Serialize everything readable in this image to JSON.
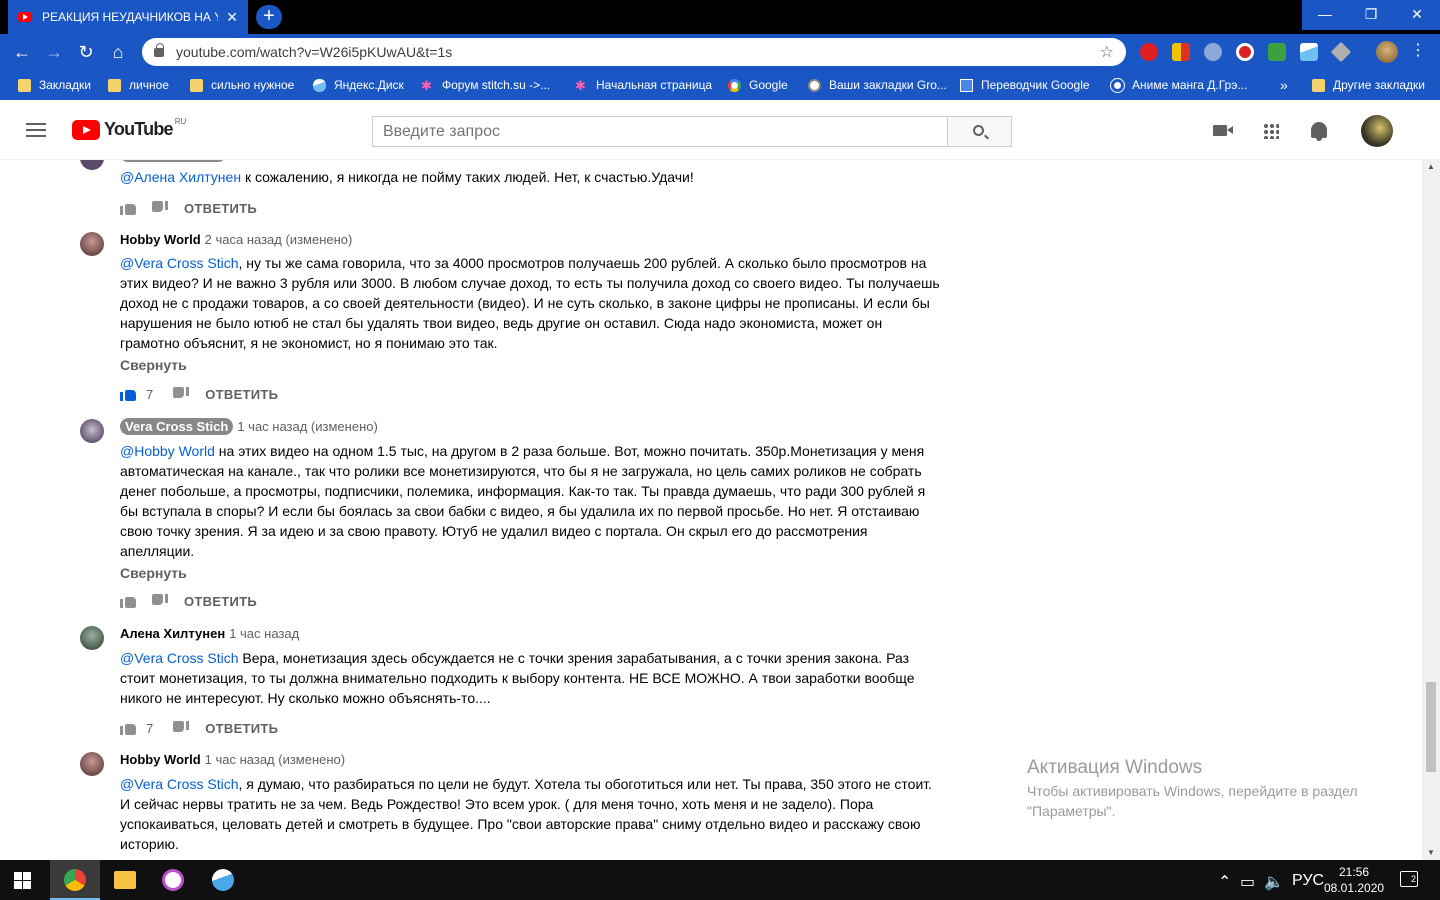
{
  "browser": {
    "tab_title": "РЕАКЦИЯ НЕУДАЧНИКОВ НА YOUTUBE",
    "url": "youtube.com/watch?v=W26i5pKUwAU&t=1s",
    "bookmarks": [
      {
        "label": "Закладки",
        "icon": "folder-icon"
      },
      {
        "label": "личное",
        "icon": "folder-icon"
      },
      {
        "label": "сильно нужное",
        "icon": "folder-icon"
      },
      {
        "label": "Яндекс.Диск",
        "icon": "yandex-disk-icon"
      },
      {
        "label": "Форум stitch.su ->...",
        "icon": "stitch-icon"
      },
      {
        "label": "Начальная страница",
        "icon": "stitch-icon"
      },
      {
        "label": "Google",
        "icon": "google-icon"
      },
      {
        "label": "Ваши закладки Gro...",
        "icon": "grammarly-icon"
      },
      {
        "label": "Переводчик Google",
        "icon": "translate-icon"
      },
      {
        "label": "Аниме манга Д.Грэ...",
        "icon": "anime-icon"
      }
    ],
    "bookmarks_more": "»",
    "other_bookmarks": "Другие закладки"
  },
  "youtube": {
    "logo_text": "YouTube",
    "region": "RU",
    "search_placeholder": "Введите запрос"
  },
  "comments": [
    {
      "author": "",
      "time": "",
      "mention": "@Алена Хилтунен",
      "text": " к сожалению, я никогда не пойму таких людей. Нет, к счастью.Удачи!",
      "likes": "",
      "collapse": ""
    },
    {
      "author": "Hobby World",
      "time": "2 часа назад (изменено)",
      "mention": "@Vera Cross Stich",
      "text": ", ну ты же сама говорила, что за 4000 просмотров получаешь 200 рублей. А сколько было просмотров на этих видео? И не важно 3 рубля или 3000. В любом случае доход, то есть ты получила доход со своего видео. Ты получаешь доход не с продажи товаров, а со своей деятельности (видео).  И не суть сколько, в законе цифры не прописаны. И если бы нарушения не было ютюб не стал бы удалять твои видео, ведь другие он оставил. Сюда надо экономиста, может он грамотно объяснит, я не экономист, но я понимаю это так.",
      "likes": "7",
      "collapse": "Свернуть"
    },
    {
      "author": "Vera Cross Stich",
      "time": "1 час назад (изменено)",
      "mention": "@Hobby World",
      "text": " на этих видео на одном 1.5 тыс, на другом в 2 раза больше. Вот, можно почитать. 350р.Монетизация у меня автоматическая на канале., так что ролики все монетизируются, что бы я не загружала, но цель самих роликов не собрать денег побольше, а просмотры, подписчики, полемика, информация. Как-то так. Ты правда думаешь, что ради 300 рублей я бы вступала в споры? И если бы боялась за свои бабки с видео, я бы удалила их по первой просьбе. Но нет. Я отстаиваю свою точку зрения. Я за идею и за свою правоту. Ютуб не удалил видео с портала. Он скрыл его до рассмотрения апелляции.",
      "likes": "",
      "collapse": "Свернуть"
    },
    {
      "author": "Алена Хилтунен",
      "time": "1 час назад",
      "mention": "@Vera Cross Stich",
      "text": " Вера, монетизация здесь обсуждается не с точки зрения зарабатывания, а с точки зрения закона. Раз стоит монетизация, то ты должна внимательно подходить к выбору контента. НЕ ВСЕ МОЖНО. А твои заработки вообще никого не интересуют. Ну сколько можно объяснять-то....",
      "likes": "7",
      "collapse": ""
    },
    {
      "author": "Hobby World",
      "time": "1 час назад (изменено)",
      "mention": "@Vera Cross Stich",
      "text": ", я думаю, что разбираться по цели не будут.  Хотела ты обоготиться или нет. Ты права, 350  этого не стоит. И сейчас нервы тратить не за чем. Ведь Рождество! Это всем урок. ( для меня точно, хоть меня и не задело). Пора успокаиваться, целовать детей и смотреть в будущее. Про \"свои авторские права\" сниму отдельно видео и расскажу свою историю.",
      "likes": "",
      "collapse": ""
    }
  ],
  "reply_label": "ОТВЕТИТЬ",
  "watermark": {
    "title": "Активация Windows",
    "line1": "Чтобы активировать Windows, перейдите в раздел",
    "line2": "\"Параметры\"."
  },
  "taskbar": {
    "lang": "РУС",
    "time": "21:56",
    "date": "08.01.2020",
    "notifications": "2"
  },
  "colors": {
    "chrome_blue": "#1a57c4",
    "link_blue": "#065fd4",
    "youtube_red": "#ff0000"
  }
}
